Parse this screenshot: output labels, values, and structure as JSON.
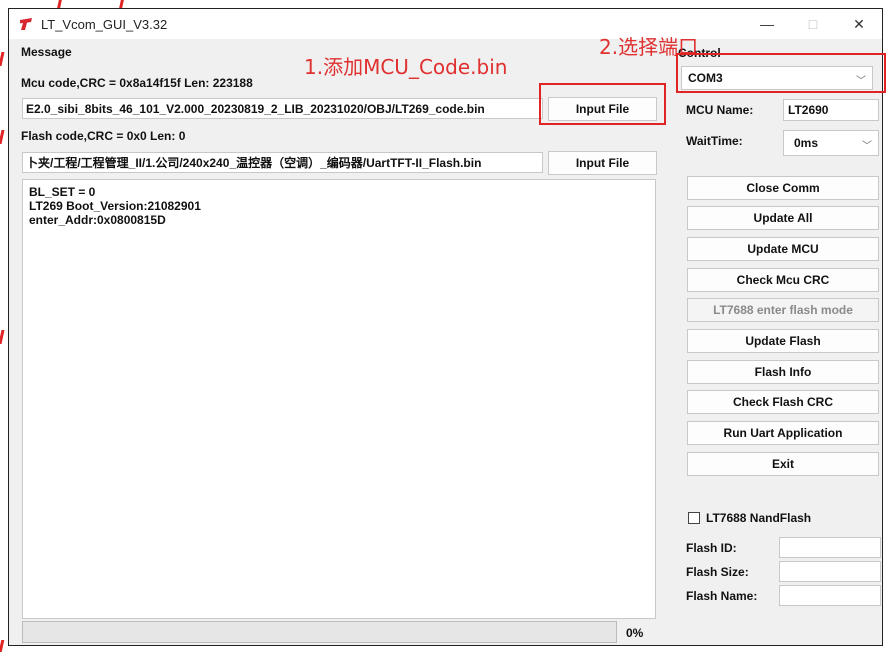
{
  "window": {
    "title": "LT_Vcom_GUI_V3.32",
    "minimize_glyph": "—",
    "maximize_glyph": "□",
    "close_glyph": "✕"
  },
  "message_panel": {
    "title": "Message",
    "mcu_info": "Mcu code,CRC = 0x8a14f15f  Len: 223188",
    "mcu_path": "E2.0_sibi_8bits_46_101_V2.000_20230819_2_LIB_20231020/OBJ/LT269_code.bin",
    "input_file_label": "Input File",
    "flash_info": "Flash code,CRC = 0x0  Len: 0",
    "flash_path": "卜夹/工程/工程管理_II/1.公司/240x240_温控器（空调）_编码器/UartTFT-II_Flash.bin",
    "log_lines": [
      "BL_SET = 0",
      "LT269 Boot_Version:21082901",
      "enter_Addr:0x0800815D"
    ],
    "progress_value": 0,
    "progress_text": "0%"
  },
  "control_panel": {
    "title": "Control",
    "com_port": "COM3",
    "mcu_name_label": "MCU Name:",
    "mcu_name_value": "LT2690",
    "wait_time_label": "WaitTime:",
    "wait_time_value": "0ms",
    "buttons": [
      "Close Comm",
      "Update All",
      "Update MCU",
      "Check Mcu CRC",
      "LT7688 enter flash mode",
      "Update Flash",
      "Flash Info",
      "Check Flash CRC",
      "Run Uart Application",
      "Exit"
    ],
    "nandflash_label": "LT7688 NandFlash",
    "nandflash_checked": false,
    "flash_id_label": "Flash ID:",
    "flash_size_label": "Flash Size:",
    "flash_name_label": "Flash Name:"
  },
  "annotations": {
    "step1": "1.添加MCU_Code.bin",
    "step2": "2.选择端口"
  },
  "colors": {
    "annotation_red": "#e02424",
    "window_bg": "#f0f0f0",
    "icon_red": "#d8262f"
  },
  "icons": {
    "app": "lt-logo-icon",
    "dropdown": "chevron-down-icon"
  }
}
